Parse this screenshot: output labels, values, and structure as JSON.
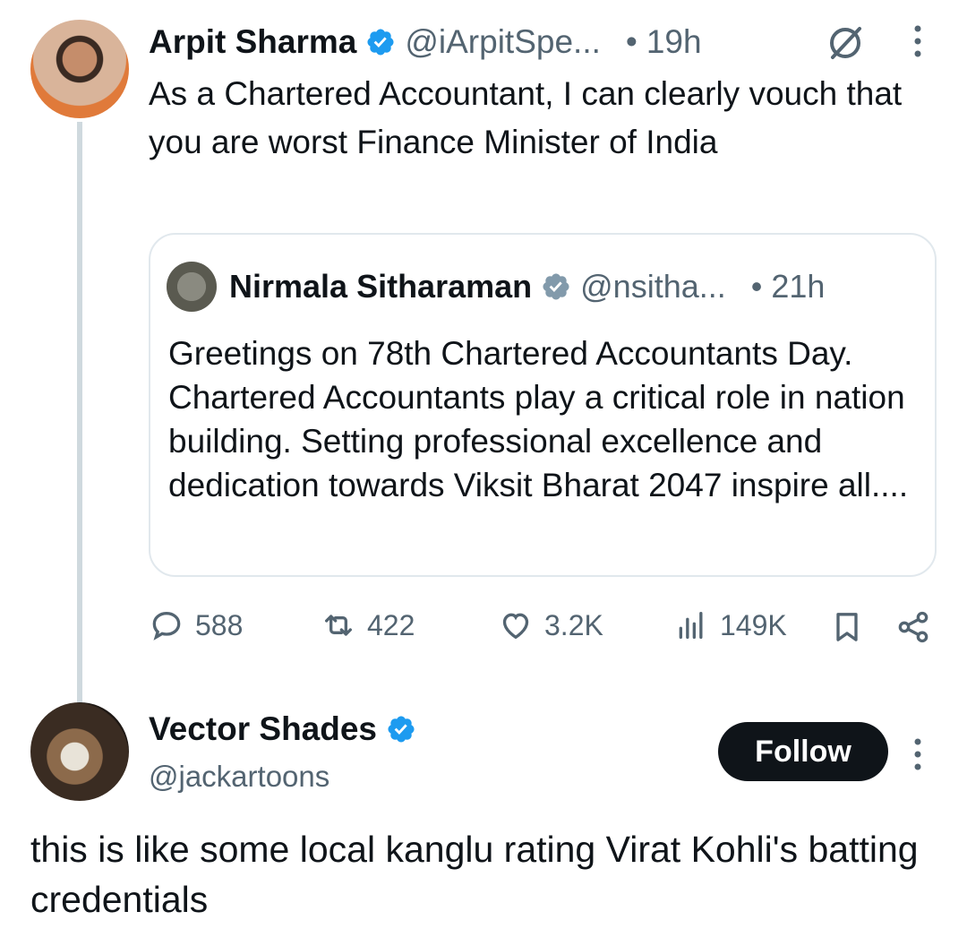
{
  "parent_tweet": {
    "author_name": "Arpit Sharma",
    "author_handle": "@iArpitSpe...",
    "separator": "•",
    "time": "19h",
    "text": "As a Chartered Accountant, I can clearly vouch that you are worst Finance Minister of India",
    "quoted": {
      "author_name": "Nirmala Sitharaman",
      "author_handle": "@nsitha...",
      "separator": "•",
      "time": "21h",
      "text": "Greetings on 78th Chartered Accountants Day. Chartered Accountants play a critical role in nation building. Setting professional excellence and dedication towards Viksit Bharat 2047 inspire all...."
    },
    "actions": {
      "replies": "588",
      "reposts": "422",
      "likes": "3.2K",
      "views": "149K"
    }
  },
  "reply": {
    "author_name": "Vector Shades",
    "author_handle": "@jackartoons",
    "follow_label": "Follow",
    "text": "this is like some local kanglu rating Virat Kohli's batting credentials"
  },
  "icons": {
    "verified": "verified-badge-icon",
    "verified_gov": "verified-gov-badge-icon",
    "grok": "grok-icon",
    "more": "more-vertical-icon",
    "reply": "reply-icon",
    "repost": "repost-icon",
    "like": "heart-icon",
    "views": "views-icon",
    "bookmark": "bookmark-icon",
    "share": "share-icon"
  },
  "colors": {
    "verified_blue": "#1d9bf0",
    "verified_gray": "#829aab",
    "text": "#0f1419",
    "secondary_text": "#536471"
  }
}
